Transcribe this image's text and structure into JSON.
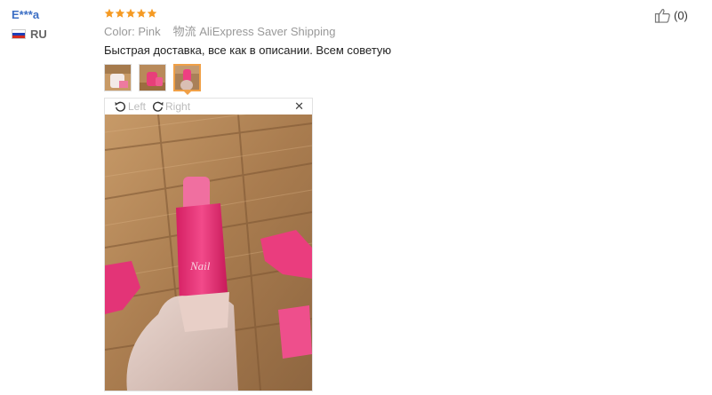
{
  "reviewer": {
    "name": "E***a",
    "country_code": "RU"
  },
  "rating": {
    "stars": 5,
    "max": 5,
    "color": "#f59a23"
  },
  "meta": {
    "color_label": "Color:",
    "color_value": "Pink",
    "shipping_label": "物流",
    "shipping_value": "AliExpress Saver Shipping"
  },
  "feedback_text": "Быстрая доставка, все как в описании. Всем советую",
  "thumbnails": [
    {
      "icon": "photo-thumbnail-1"
    },
    {
      "icon": "photo-thumbnail-2"
    },
    {
      "icon": "photo-thumbnail-3",
      "active": true
    }
  ],
  "viewer": {
    "rotate_left_label": "Left",
    "rotate_right_label": "Right",
    "close_icon": "close-icon"
  },
  "like": {
    "count_text": "(0)"
  },
  "colors": {
    "username": "#3b6ec4",
    "accent_border": "#f0a047",
    "star": "#f59a23"
  }
}
